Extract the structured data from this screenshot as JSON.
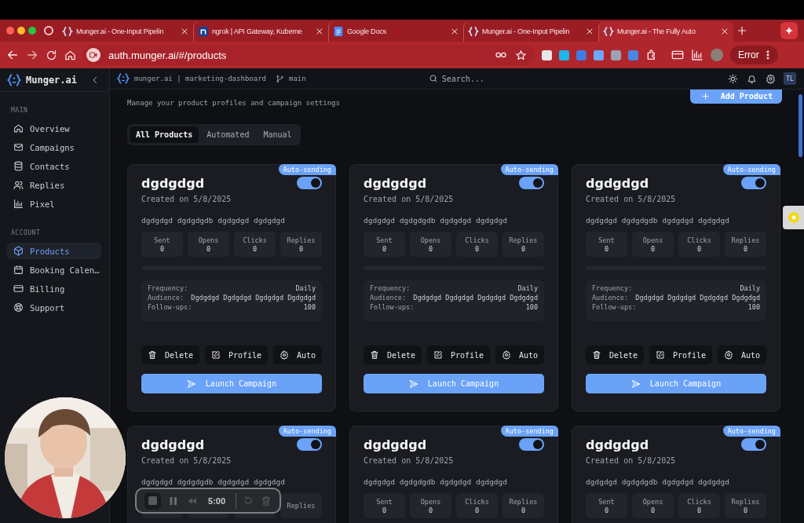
{
  "browser": {
    "tabs": [
      {
        "title": "Munger.ai - One-Input Pipelin",
        "selected": false
      },
      {
        "title": "ngrok | API Gateway, Kuberne",
        "selected": false
      },
      {
        "title": "Google Docs",
        "selected": false
      },
      {
        "title": "Munger.ai - One-Input Pipelin",
        "selected": false
      },
      {
        "title": "Munger.ai - The Fully Auto",
        "selected": true
      }
    ],
    "url": "auth.munger.ai/#/products",
    "profile_button": "Error"
  },
  "sidebar": {
    "brand": "Munger.ai",
    "sections": [
      {
        "heading": "MAIN",
        "items": [
          {
            "label": "Overview",
            "selected": false
          },
          {
            "label": "Campaigns",
            "selected": false
          },
          {
            "label": "Contacts",
            "selected": false
          },
          {
            "label": "Replies",
            "selected": false
          },
          {
            "label": "Pixel",
            "selected": false
          }
        ]
      },
      {
        "heading": "ACCOUNT",
        "items": [
          {
            "label": "Products",
            "selected": true
          },
          {
            "label": "Booking Calen…",
            "selected": false
          },
          {
            "label": "Billing",
            "selected": false
          },
          {
            "label": "Support",
            "selected": false
          }
        ]
      }
    ]
  },
  "header": {
    "project": "munger.ai | marketing-dashboard",
    "branch": "main",
    "search_placeholder": "Search...",
    "avatar": "TL"
  },
  "page": {
    "subtitle": "Manage your product profiles and campaign settings",
    "add_button": "Add Product",
    "filter_tabs": [
      {
        "label": "All Products",
        "selected": true
      },
      {
        "label": "Automated",
        "selected": false
      },
      {
        "label": "Manual",
        "selected": false
      }
    ],
    "products": [
      {
        "title": "dgdgdgd",
        "created": "Created on 5/8/2025",
        "badge": "Auto-sending",
        "auto_on": true,
        "description": "dgdgdgd dgdgdgdb dgdgdgd dgdgdgd",
        "stats": [
          {
            "kind": "shown",
            "label": "Sent",
            "value": "0"
          },
          {
            "kind": "shown",
            "label": "Opens",
            "value": "0"
          },
          {
            "kind": "shown",
            "label": "Clicks",
            "value": "0"
          },
          {
            "kind": "shown",
            "label": "Replies",
            "value": "0"
          }
        ],
        "details": [
          {
            "label": "Frequency:",
            "value": "Daily"
          },
          {
            "label": "Audience:",
            "value": "Dgdgdgd Dgdgdgd Dgdgdgd Dgdgdgd"
          },
          {
            "label": "Follow-ups:",
            "value": "100"
          }
        ],
        "actions": [
          {
            "label": "Delete"
          },
          {
            "label": "Profile"
          },
          {
            "label": "Auto"
          }
        ],
        "launch": "Launch Campaign"
      },
      {
        "title": "dgdgdgd",
        "created": "Created on 5/8/2025",
        "badge": "Auto-sending",
        "auto_on": true,
        "description": "dgdgdgd dgdgdgdb dgdgdgd dgdgdgd",
        "stats": [
          {
            "kind": "shown",
            "label": "Sent",
            "value": "0"
          },
          {
            "kind": "shown",
            "label": "Opens",
            "value": "0"
          },
          {
            "kind": "shown",
            "label": "Clicks",
            "value": "0"
          },
          {
            "kind": "shown",
            "label": "Replies",
            "value": "0"
          }
        ],
        "details": [
          {
            "label": "Frequency:",
            "value": "Daily"
          },
          {
            "label": "Audience:",
            "value": "Dgdgdgd Dgdgdgd Dgdgdgd Dgdgdgd"
          },
          {
            "label": "Follow-ups:",
            "value": "100"
          }
        ],
        "actions": [
          {
            "label": "Delete"
          },
          {
            "label": "Profile"
          },
          {
            "label": "Auto"
          }
        ],
        "launch": "Launch Campaign"
      },
      {
        "title": "dgdgdgd",
        "created": "Created on 5/8/2025",
        "badge": "Auto-sending",
        "auto_on": true,
        "description": "dgdgdgd dgdgdgdb dgdgdgd dgdgdgd",
        "stats": [
          {
            "kind": "shown",
            "label": "Sent",
            "value": "0"
          },
          {
            "kind": "shown",
            "label": "Opens",
            "value": "0"
          },
          {
            "kind": "shown",
            "label": "Clicks",
            "value": "0"
          },
          {
            "kind": "shown",
            "label": "Replies",
            "value": "0"
          }
        ],
        "details": [
          {
            "label": "Frequency:",
            "value": "Daily"
          },
          {
            "label": "Audience:",
            "value": "Dgdgdgd Dgdgdgd Dgdgdgd Dgdgdgd"
          },
          {
            "label": "Follow-ups:",
            "value": "100"
          }
        ],
        "actions": [
          {
            "label": "Delete"
          },
          {
            "label": "Profile"
          },
          {
            "label": "Auto"
          }
        ],
        "launch": "Launch Campaign"
      },
      {
        "title": "dgdgdgd",
        "created": "Created on 5/8/2025",
        "badge": "Auto-sending",
        "auto_on": true,
        "description": "dgdgdgd dgdgdgdb dgdgdgd dgdgdgd",
        "stats": [
          {
            "kind": "hidden"
          },
          {
            "kind": "hidden"
          },
          {
            "kind": "hidden"
          },
          {
            "kind": "shown",
            "label": "Replies"
          }
        ]
      },
      {
        "title": "dgdgdgd",
        "created": "Created on 5/8/2025",
        "badge": "Auto-sending",
        "auto_on": true,
        "description": "dgdgdgd dgdgdgdb dgdgdgd dgdgdgd",
        "stats": [
          {
            "kind": "shown",
            "label": "Sent",
            "value": "0"
          },
          {
            "kind": "shown",
            "label": "Opens",
            "value": "0"
          },
          {
            "kind": "shown",
            "label": "Clicks",
            "value": "0"
          },
          {
            "kind": "shown",
            "label": "Replies",
            "value": "0"
          }
        ]
      },
      {
        "title": "dgdgdgd",
        "created": "Created on 5/8/2025",
        "badge": "Auto-sending",
        "auto_on": true,
        "description": "dgdgdgd dgdgdgdb dgdgdgd dgdgdgd",
        "stats": [
          {
            "kind": "shown",
            "label": "Sent",
            "value": "0"
          },
          {
            "kind": "shown",
            "label": "Opens",
            "value": "0"
          },
          {
            "kind": "shown",
            "label": "Clicks",
            "value": "0"
          },
          {
            "kind": "shown",
            "label": "Replies",
            "value": "0"
          }
        ]
      }
    ]
  },
  "recorder": {
    "time": "5:00"
  }
}
